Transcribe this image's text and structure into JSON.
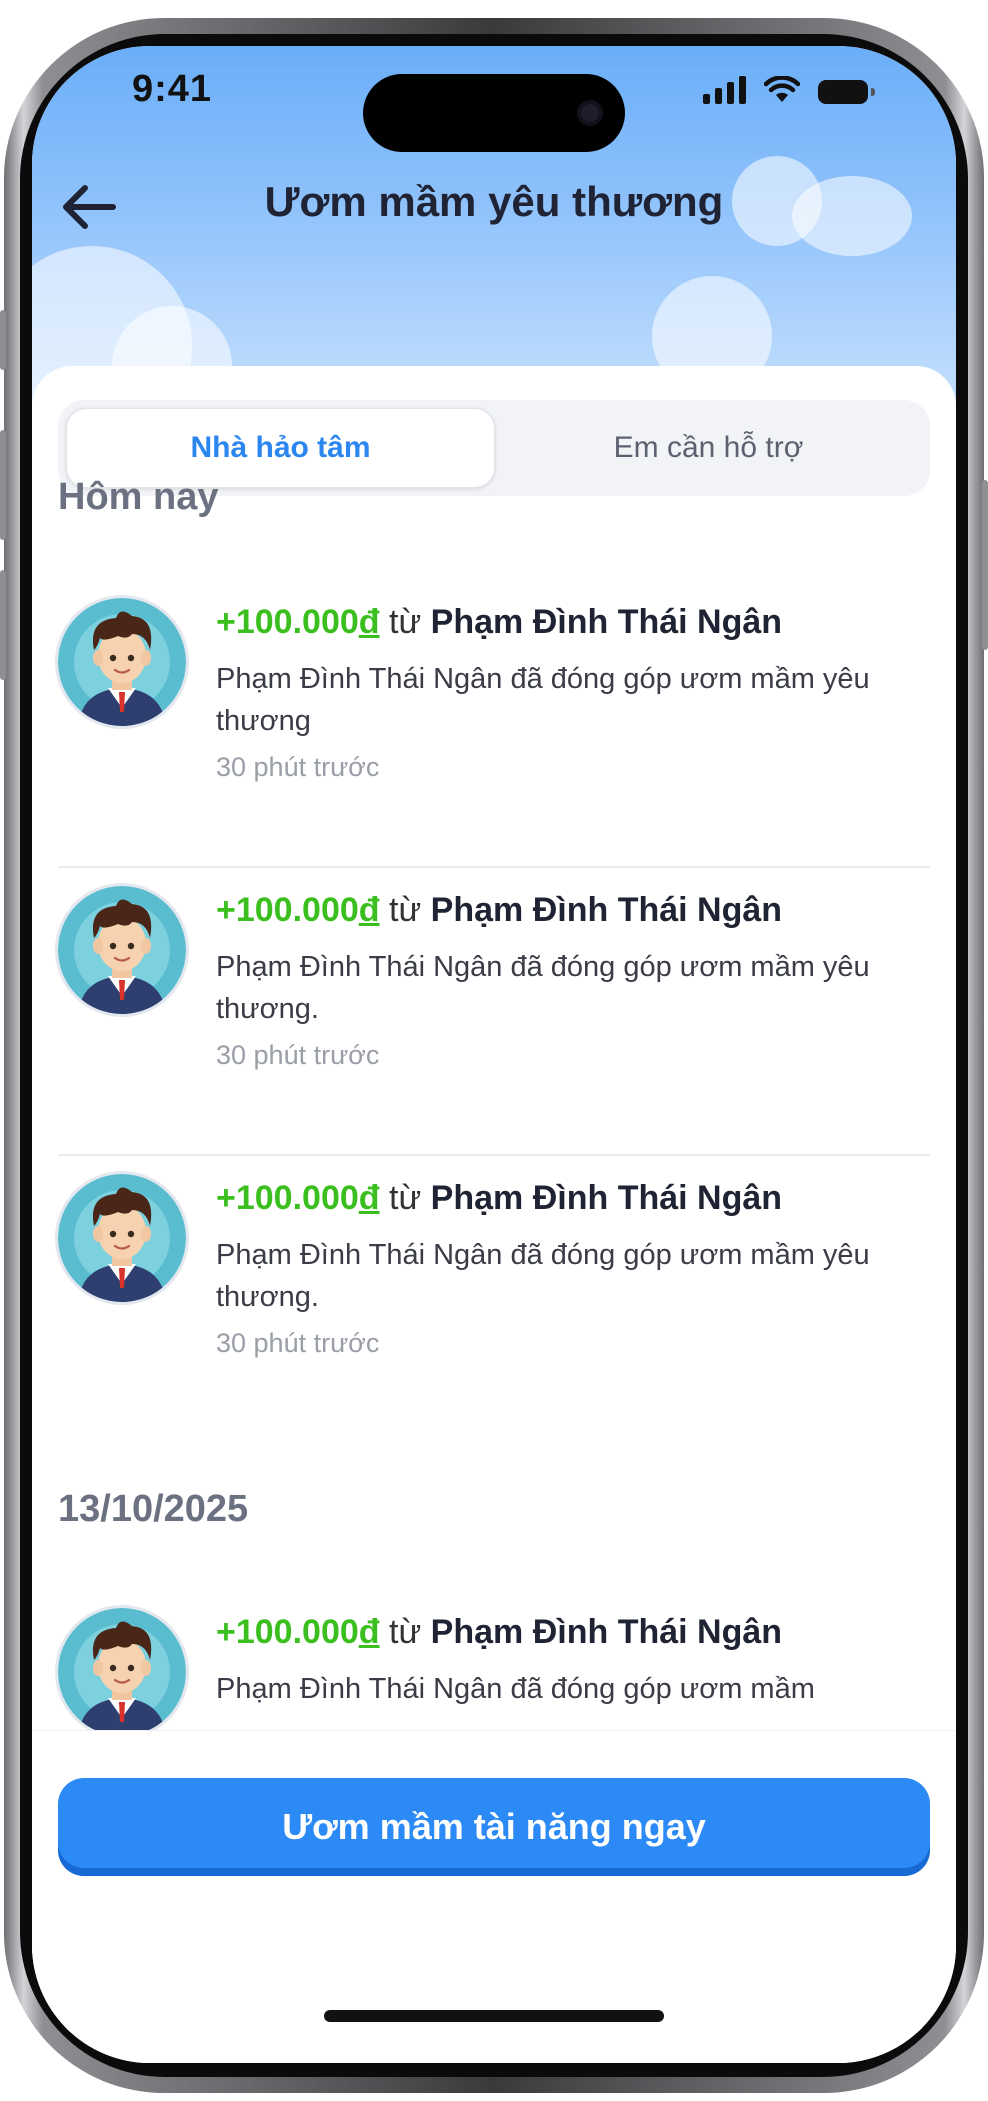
{
  "status_bar": {
    "time": "9:41"
  },
  "header": {
    "title": "Ươm mầm yêu thương",
    "back_icon": "arrow-left-icon"
  },
  "tabs": [
    {
      "label": "Nhà hảo tâm",
      "active": true
    },
    {
      "label": "Em cần hỗ trợ",
      "active": false
    }
  ],
  "sections": [
    {
      "label": "Hôm nay",
      "items": [
        {
          "amount": "+100.000",
          "currency": "đ",
          "from_word": "từ",
          "donor": "Phạm Đình Thái Ngân",
          "description": "Phạm Đình Thái Ngân đã đóng góp ươm mầm yêu thương",
          "time": "30 phút trước"
        },
        {
          "amount": "+100.000",
          "currency": "đ",
          "from_word": "từ",
          "donor": "Phạm Đình Thái Ngân",
          "description": "Phạm Đình Thái Ngân đã đóng góp ươm mầm yêu thương.",
          "time": "30 phút trước"
        },
        {
          "amount": "+100.000",
          "currency": "đ",
          "from_word": "từ",
          "donor": "Phạm Đình Thái Ngân",
          "description": "Phạm Đình Thái Ngân đã đóng góp ươm mầm yêu thương.",
          "time": "30 phút trước"
        }
      ]
    },
    {
      "label": "13/10/2025",
      "items": [
        {
          "amount": "+100.000",
          "currency": "đ",
          "from_word": "từ",
          "donor": "Phạm Đình Thái Ngân",
          "description": "Phạm Đình Thái Ngân đã đóng góp ươm mầm"
        }
      ]
    }
  ],
  "cta": {
    "label": "Ươm mầm tài năng ngay"
  },
  "colors": {
    "accent": "#2b8af5",
    "amount_green": "#3bbf1f",
    "sky": "#6aaef8"
  }
}
